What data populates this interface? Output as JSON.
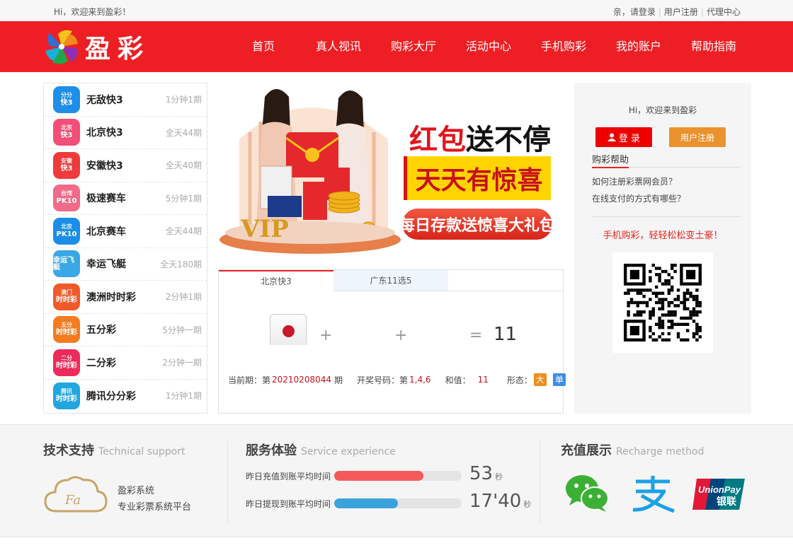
{
  "topbar": {
    "welcome": "Hi，欢迎来到盈彩！",
    "login_prompt": "亲，请登录",
    "register": "用户注册",
    "agent": "代理中心"
  },
  "header": {
    "logo_text": "盈彩",
    "nav": [
      "首页",
      "真人视讯",
      "购彩大厅",
      "活动中心",
      "手机购彩",
      "我的账户",
      "帮助指南"
    ]
  },
  "games": [
    {
      "name": "无敌快3",
      "freq": "1分钟1期",
      "icon": {
        "top": "分分",
        "main": "快3",
        "color": "#1e8fe8"
      }
    },
    {
      "name": "北京快3",
      "freq": "全天44期",
      "icon": {
        "top": "北京",
        "main": "快3",
        "color": "#f24e78"
      }
    },
    {
      "name": "安徽快3",
      "freq": "全天40期",
      "icon": {
        "top": "安徽",
        "main": "快3",
        "color": "#ef3b3b"
      }
    },
    {
      "name": "极速赛车",
      "freq": "5分钟1期",
      "icon": {
        "top": "台湾",
        "main": "PK10",
        "color": "#f06a8a"
      }
    },
    {
      "name": "北京赛车",
      "freq": "全天44期",
      "icon": {
        "top": "北京",
        "main": "PK10",
        "color": "#1a8ee8"
      }
    },
    {
      "name": "幸运飞艇",
      "freq": "全天180期",
      "icon": {
        "top": "",
        "main": "幸运飞艇",
        "color": "#3aa8e6"
      }
    },
    {
      "name": "澳洲时时彩",
      "freq": "2分钟1期",
      "icon": {
        "top": "澳门",
        "main": "时时彩",
        "color": "#f05a28"
      }
    },
    {
      "name": "五分彩",
      "freq": "5分钟一期",
      "icon": {
        "top": "五分",
        "main": "时时彩",
        "color": "#f47b20"
      }
    },
    {
      "name": "二分彩",
      "freq": "2分钟一期",
      "icon": {
        "top": "二分",
        "main": "时时彩",
        "color": "#ee2a5a"
      }
    },
    {
      "name": "腾讯分分彩",
      "freq": "1分钟1期",
      "icon": {
        "top": "腾讯",
        "main": "时时彩",
        "color": "#22a6e0"
      }
    }
  ],
  "banner": {
    "line1_red": "红包",
    "line1_black": "送不停",
    "line2": "天天有惊喜",
    "line3": "每日存款送惊喜大礼包",
    "vip": "VIP"
  },
  "result": {
    "tabs": [
      "北京快3",
      "广东11选5"
    ],
    "plus": "+",
    "equals": "=",
    "sum": "11",
    "period_label": "当前期：第",
    "period": "20210208044",
    "period_suffix": "期",
    "numbers_label": "开奖号码：第",
    "numbers": "1,4,6",
    "sum_label": "和值：",
    "sum_value": "11",
    "shape_label": "形态：",
    "badge_big": "大",
    "badge_odd": "单",
    "colors": {
      "big": "#f08c1e",
      "odd": "#3a8ee6"
    }
  },
  "right_panel": {
    "hi": "Hi，欢迎来到盈彩",
    "login": "登 录",
    "register": "用户注册",
    "help_title": "购彩帮助",
    "questions": [
      "如何注册彩票网会员？",
      "在线支付的方式有哪些？"
    ],
    "mobile_slogan": "手机购彩，轻轻松松变土豪！"
  },
  "footer": {
    "support": {
      "title": "技术支持",
      "en": "Technical support",
      "system": "盈彩系统",
      "desc": "专业彩票系统平台"
    },
    "service": {
      "title": "服务体验",
      "en": "Service experience",
      "rows": [
        {
          "label": "昨日充值到账平均时间",
          "value": "53",
          "unit": "秒",
          "fill": 0.7,
          "color": "#f55a5a"
        },
        {
          "label": "昨日提现到账平均时间",
          "value": "17'40",
          "unit": "秒",
          "fill": 0.5,
          "color": "#3aa3dc"
        }
      ]
    },
    "recharge": {
      "title": "充值展示",
      "en": "Recharge method",
      "unionpay_en": "UnionPay",
      "unionpay_cn": "银联"
    }
  }
}
